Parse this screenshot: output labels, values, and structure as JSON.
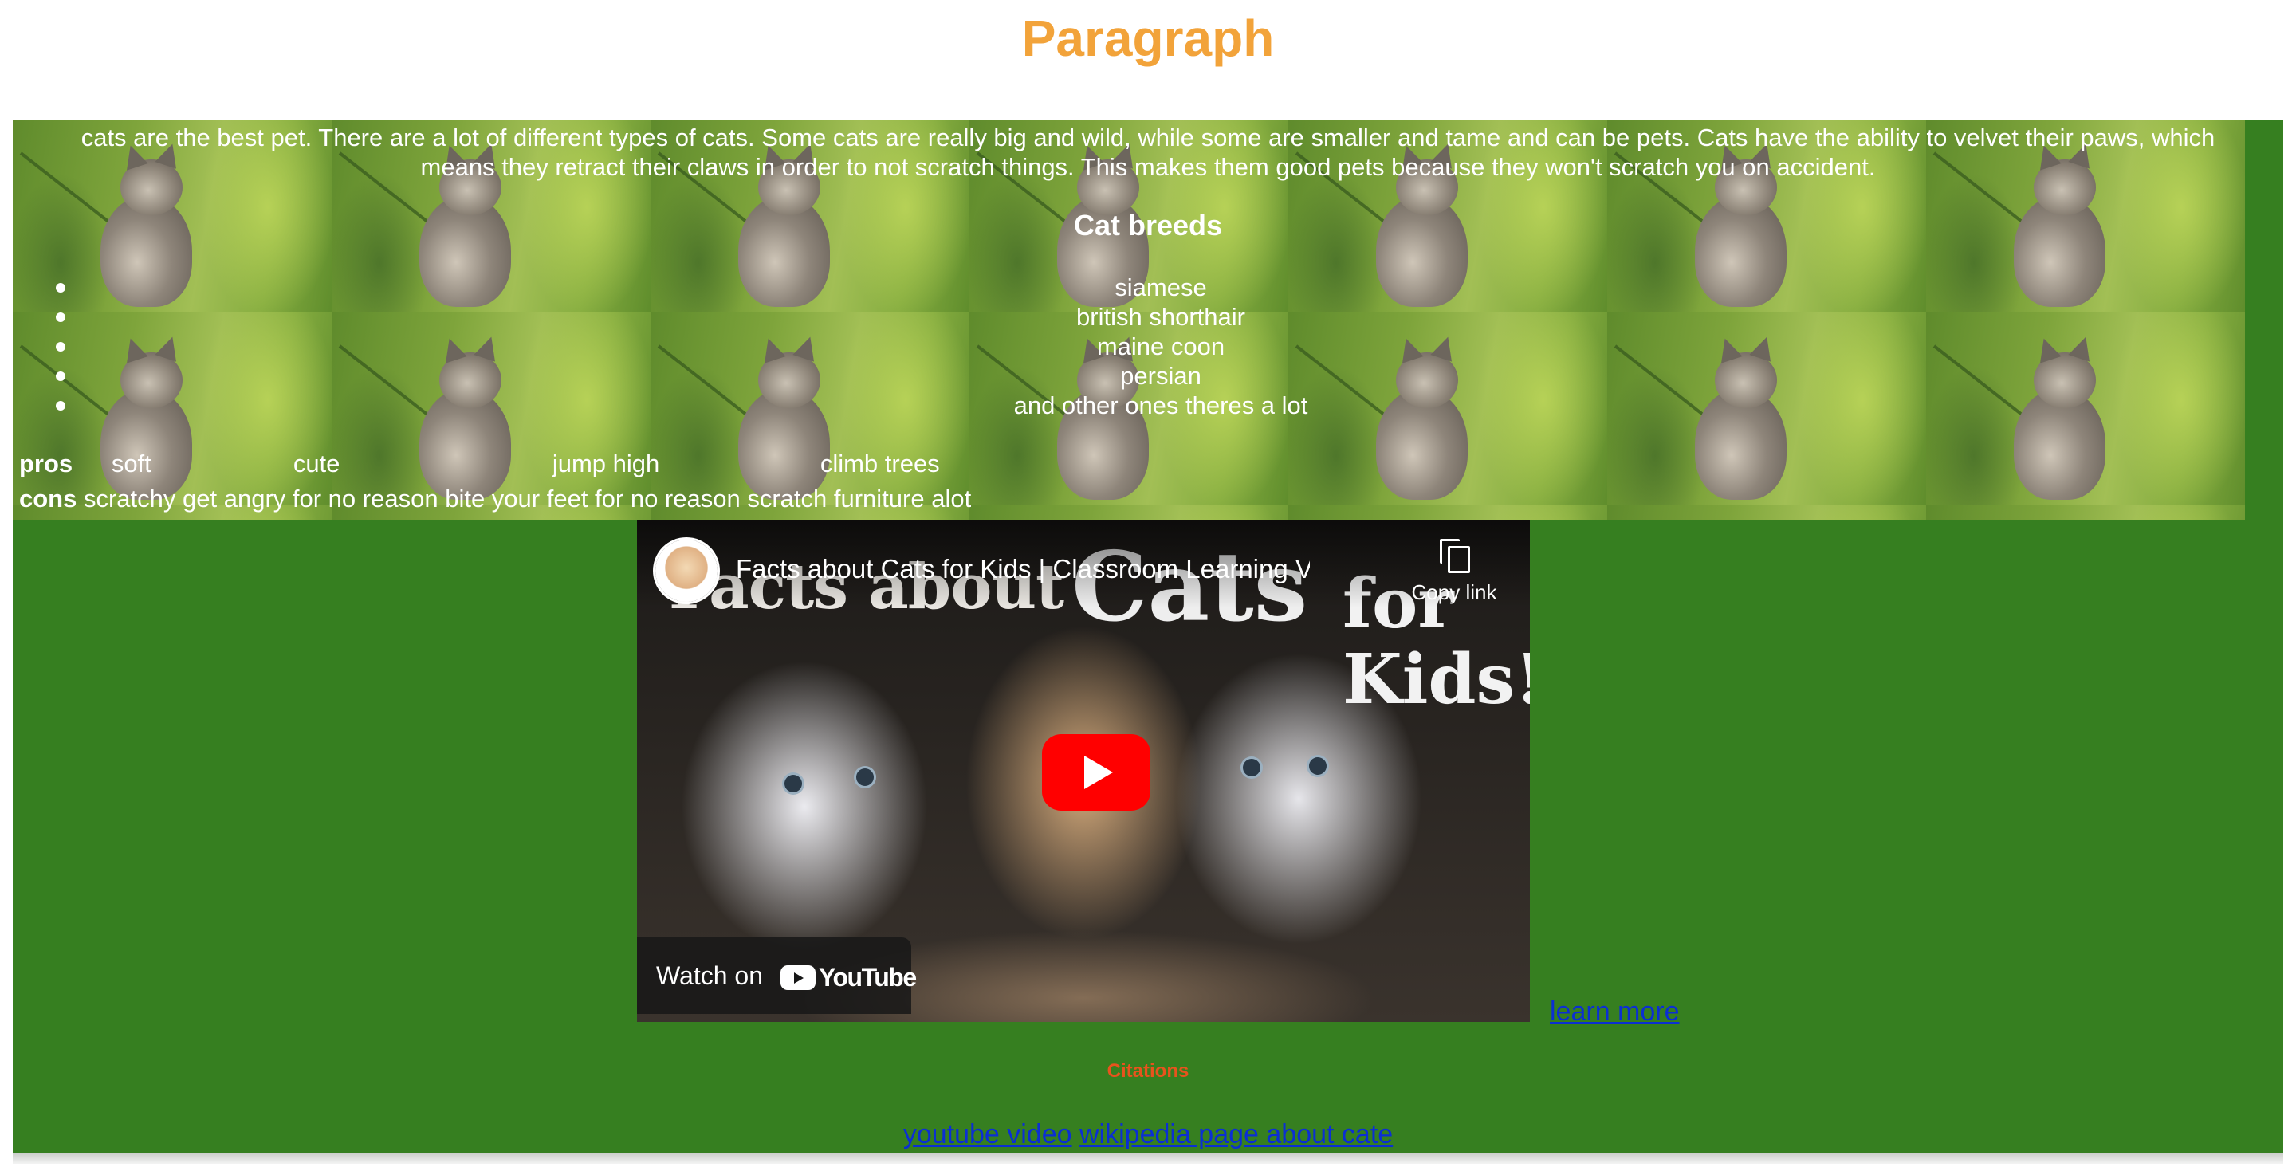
{
  "page": {
    "title": "Paragraph",
    "title_color": "#f2a33a"
  },
  "intro": {
    "text": "cats are the best pet. There are a lot of different types of cats. Some cats are really big and wild, while some are smaller and tame and can be pets. Cats have the ability to velvet their paws, which means they retract their claws in order to not scratch things. This makes them good pets because they won't scratch you on accident."
  },
  "breeds": {
    "heading": "Cat breeds",
    "items": [
      "siamese",
      "british shorthair",
      "maine coon",
      "persian",
      "and other ones theres a lot"
    ]
  },
  "pros_cons": {
    "pros_label": "pros",
    "pros": [
      "soft",
      "cute",
      "jump high",
      "climb trees"
    ],
    "cons_label": "cons",
    "cons": [
      "scratchy",
      "get angry for no reason",
      "bite your feet for no reason",
      "scratch furniture alot"
    ]
  },
  "video": {
    "title": "Facts about Cats for Kids | Classroom Learning Vi...",
    "copy_link_label": "Copy link",
    "watch_on_label": "Watch on",
    "youtube_word": "YouTube",
    "thumb_line_1": "Facts about",
    "thumb_line_2": "Cats",
    "thumb_line_3": "for",
    "thumb_line_4": "Kids!"
  },
  "learn_more": "learn more",
  "citations": {
    "heading": "Citations",
    "heading_color": "#e8531d",
    "link_1": "youtube video",
    "link_2": "wikipedia page about cate"
  },
  "colors": {
    "frame_bg": "#367f20",
    "link": "#0b2fd4",
    "youtube_red": "#ff0000"
  },
  "icons": {
    "copy": "copy-icon",
    "play": "play-icon",
    "youtube": "youtube-logo-icon"
  }
}
